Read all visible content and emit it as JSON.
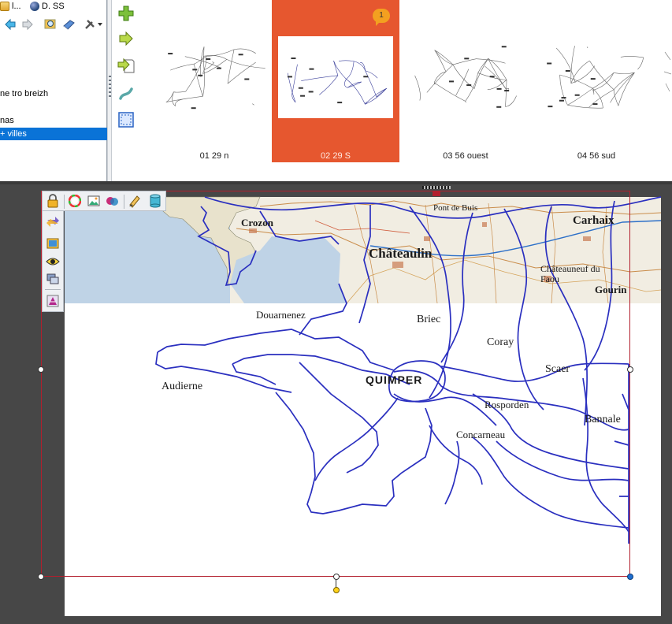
{
  "tree_panel": {
    "tabs": [
      {
        "label": "l...",
        "icon": "folder-icon"
      },
      {
        "label": "D. SS",
        "icon": "globe-icon"
      }
    ],
    "toolbar_icons": [
      "back-arrow-icon",
      "forward-arrow-icon",
      "search-icon",
      "book-icon",
      "tools-icon"
    ],
    "rows": [
      {
        "label": "ne tro breizh",
        "selected": false
      },
      {
        "label": "nas",
        "selected": false
      },
      {
        "label": "+ villes",
        "selected": true
      }
    ]
  },
  "strip": {
    "tool_icons": [
      "add-page-icon",
      "next-arrow-icon",
      "export-page-icon",
      "curve-icon",
      "fit-frame-icon"
    ],
    "badge": "1",
    "thumbnails": [
      {
        "label": "01 29 n",
        "selected": false
      },
      {
        "label": "02 29 S",
        "selected": true
      },
      {
        "label": "03 56 ouest",
        "selected": false
      },
      {
        "label": "04 56 sud",
        "selected": false
      }
    ]
  },
  "palette": {
    "top_icons": [
      "lock-icon",
      "color-wheel-icon",
      "image-icon",
      "color-overlap-icon",
      "pencil-eraser-icon",
      "database-icon"
    ],
    "left_icons": [
      "swap-arrows-icon",
      "picture-icon",
      "eye-icon",
      "layers-icon",
      "text-frame-icon"
    ]
  },
  "map": {
    "base_labels": [
      "Crozon",
      "Pont de Buis",
      "Carhaix",
      "Châteaulin",
      "Châteauneuf du",
      "Faou",
      "Gourin"
    ],
    "labels": [
      "Douarnenez",
      "Briec",
      "Coray",
      "Audierne",
      "QUIMPER",
      "Scaer",
      "Rosporden",
      "Bannale",
      "Concarneau"
    ]
  },
  "colors": {
    "accent_selected": "#e6572f",
    "tree_selection": "#0a73d7",
    "editor_background": "#474747",
    "frame_red": "#b21f2d",
    "road_blue": "#2a2fbf"
  }
}
